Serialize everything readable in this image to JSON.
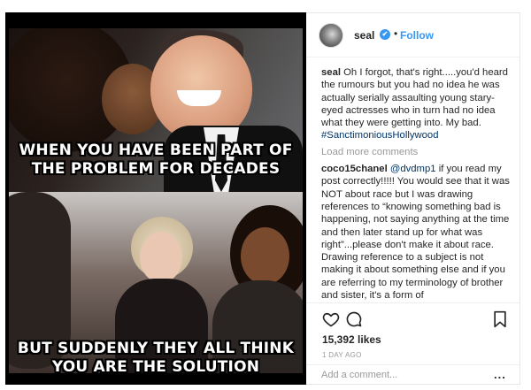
{
  "post": {
    "image_caption_top": "WHEN YOU HAVE BEEN PART OF THE PROBLEM FOR DECADES",
    "image_caption_bottom": "BUT SUDDENLY THEY ALL THINK YOU ARE THE SOLUTION"
  },
  "header": {
    "username": "seal",
    "verified_icon": "✔",
    "separator": "•",
    "follow_label": "Follow"
  },
  "comments": {
    "caption_user": "seal",
    "caption_text": "Oh I forgot, that's right.....you'd heard the rumours but you had no idea he was actually serially assaulting young stary-eyed actresses who in turn had no idea what they were getting into. My bad.",
    "caption_hashtag": "#SanctimoniousHollywood",
    "load_more": "Load more comments",
    "reply_user": "coco15chanel",
    "reply_mention": "@dvdmp1",
    "reply_text": "if you read my post correctly!!!!! You would see that it was NOT about race but I was drawing references to “knowing something bad is happening, not saying anything at the time and then later stand up for what was right”...please don't make it about race. Drawing reference to a subject is not making it about something else and if you are referring to my terminology of brother and sister, it's a form of endearment....please read AGAIN!!!"
  },
  "actions": {
    "heart_icon": "heart-icon",
    "comment_icon": "comment-icon",
    "bookmark_icon": "bookmark-icon"
  },
  "stats": {
    "likes": "15,392 likes",
    "time_ago": "1 DAY AGO"
  },
  "add_comment": {
    "placeholder": "Add a comment...",
    "more_label": "..."
  },
  "colors": {
    "link_blue": "#3897f0",
    "hashtag_navy": "#003569",
    "muted_gray": "#999999"
  }
}
